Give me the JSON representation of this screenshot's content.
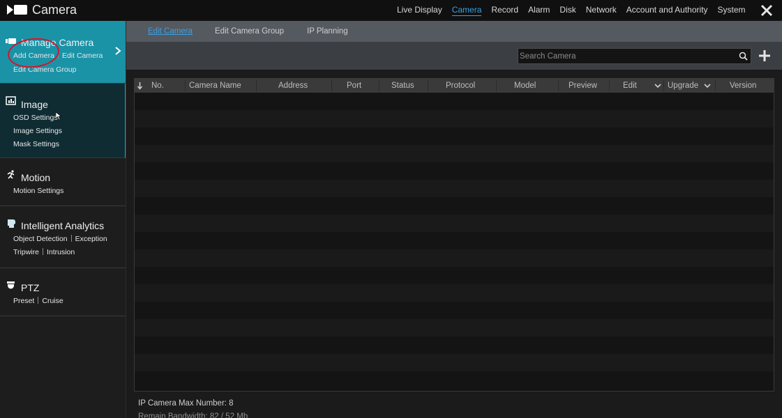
{
  "app": {
    "title": "Camera"
  },
  "topnav": [
    {
      "label": "Live Display",
      "active": false
    },
    {
      "label": "Camera",
      "active": true
    },
    {
      "label": "Record",
      "active": false
    },
    {
      "label": "Alarm",
      "active": false
    },
    {
      "label": "Disk",
      "active": false
    },
    {
      "label": "Network",
      "active": false
    },
    {
      "label": "Account and Authority",
      "active": false
    },
    {
      "label": "System",
      "active": false
    }
  ],
  "sidebar": {
    "manage": {
      "title": "Manage Camera",
      "links": [
        "Add Camera",
        "Edit Camera",
        "Edit Camera Group"
      ]
    },
    "image": {
      "title": "Image",
      "links": [
        "OSD Settings",
        "Image Settings",
        "Mask Settings"
      ]
    },
    "motion": {
      "title": "Motion",
      "links": [
        "Motion Settings"
      ]
    },
    "analytics": {
      "title": "Intelligent Analytics",
      "links": [
        "Object Detection",
        "Exception",
        "Tripwire",
        "Intrusion"
      ]
    },
    "ptz": {
      "title": "PTZ",
      "links": [
        "Preset",
        "Cruise"
      ]
    }
  },
  "tabs": [
    {
      "label": "Edit Camera",
      "active": true
    },
    {
      "label": "Edit Camera Group",
      "active": false
    },
    {
      "label": "IP Planning",
      "active": false
    }
  ],
  "search": {
    "placeholder": "Search Camera"
  },
  "table": {
    "headers": [
      "No.",
      "Camera Name",
      "Address",
      "Port",
      "Status",
      "Protocol",
      "Model",
      "Preview",
      "Edit",
      "Upgrade",
      "Version"
    ],
    "rows": []
  },
  "footer": {
    "max_number": "IP Camera Max Number: 8",
    "bandwidth_partial": "Remain Bandwidth: 82 / 52 Mb"
  },
  "colors": {
    "accent": "#3aa0e6",
    "sidebar_active": "#1a93a7",
    "annotation": "#d6152b"
  }
}
